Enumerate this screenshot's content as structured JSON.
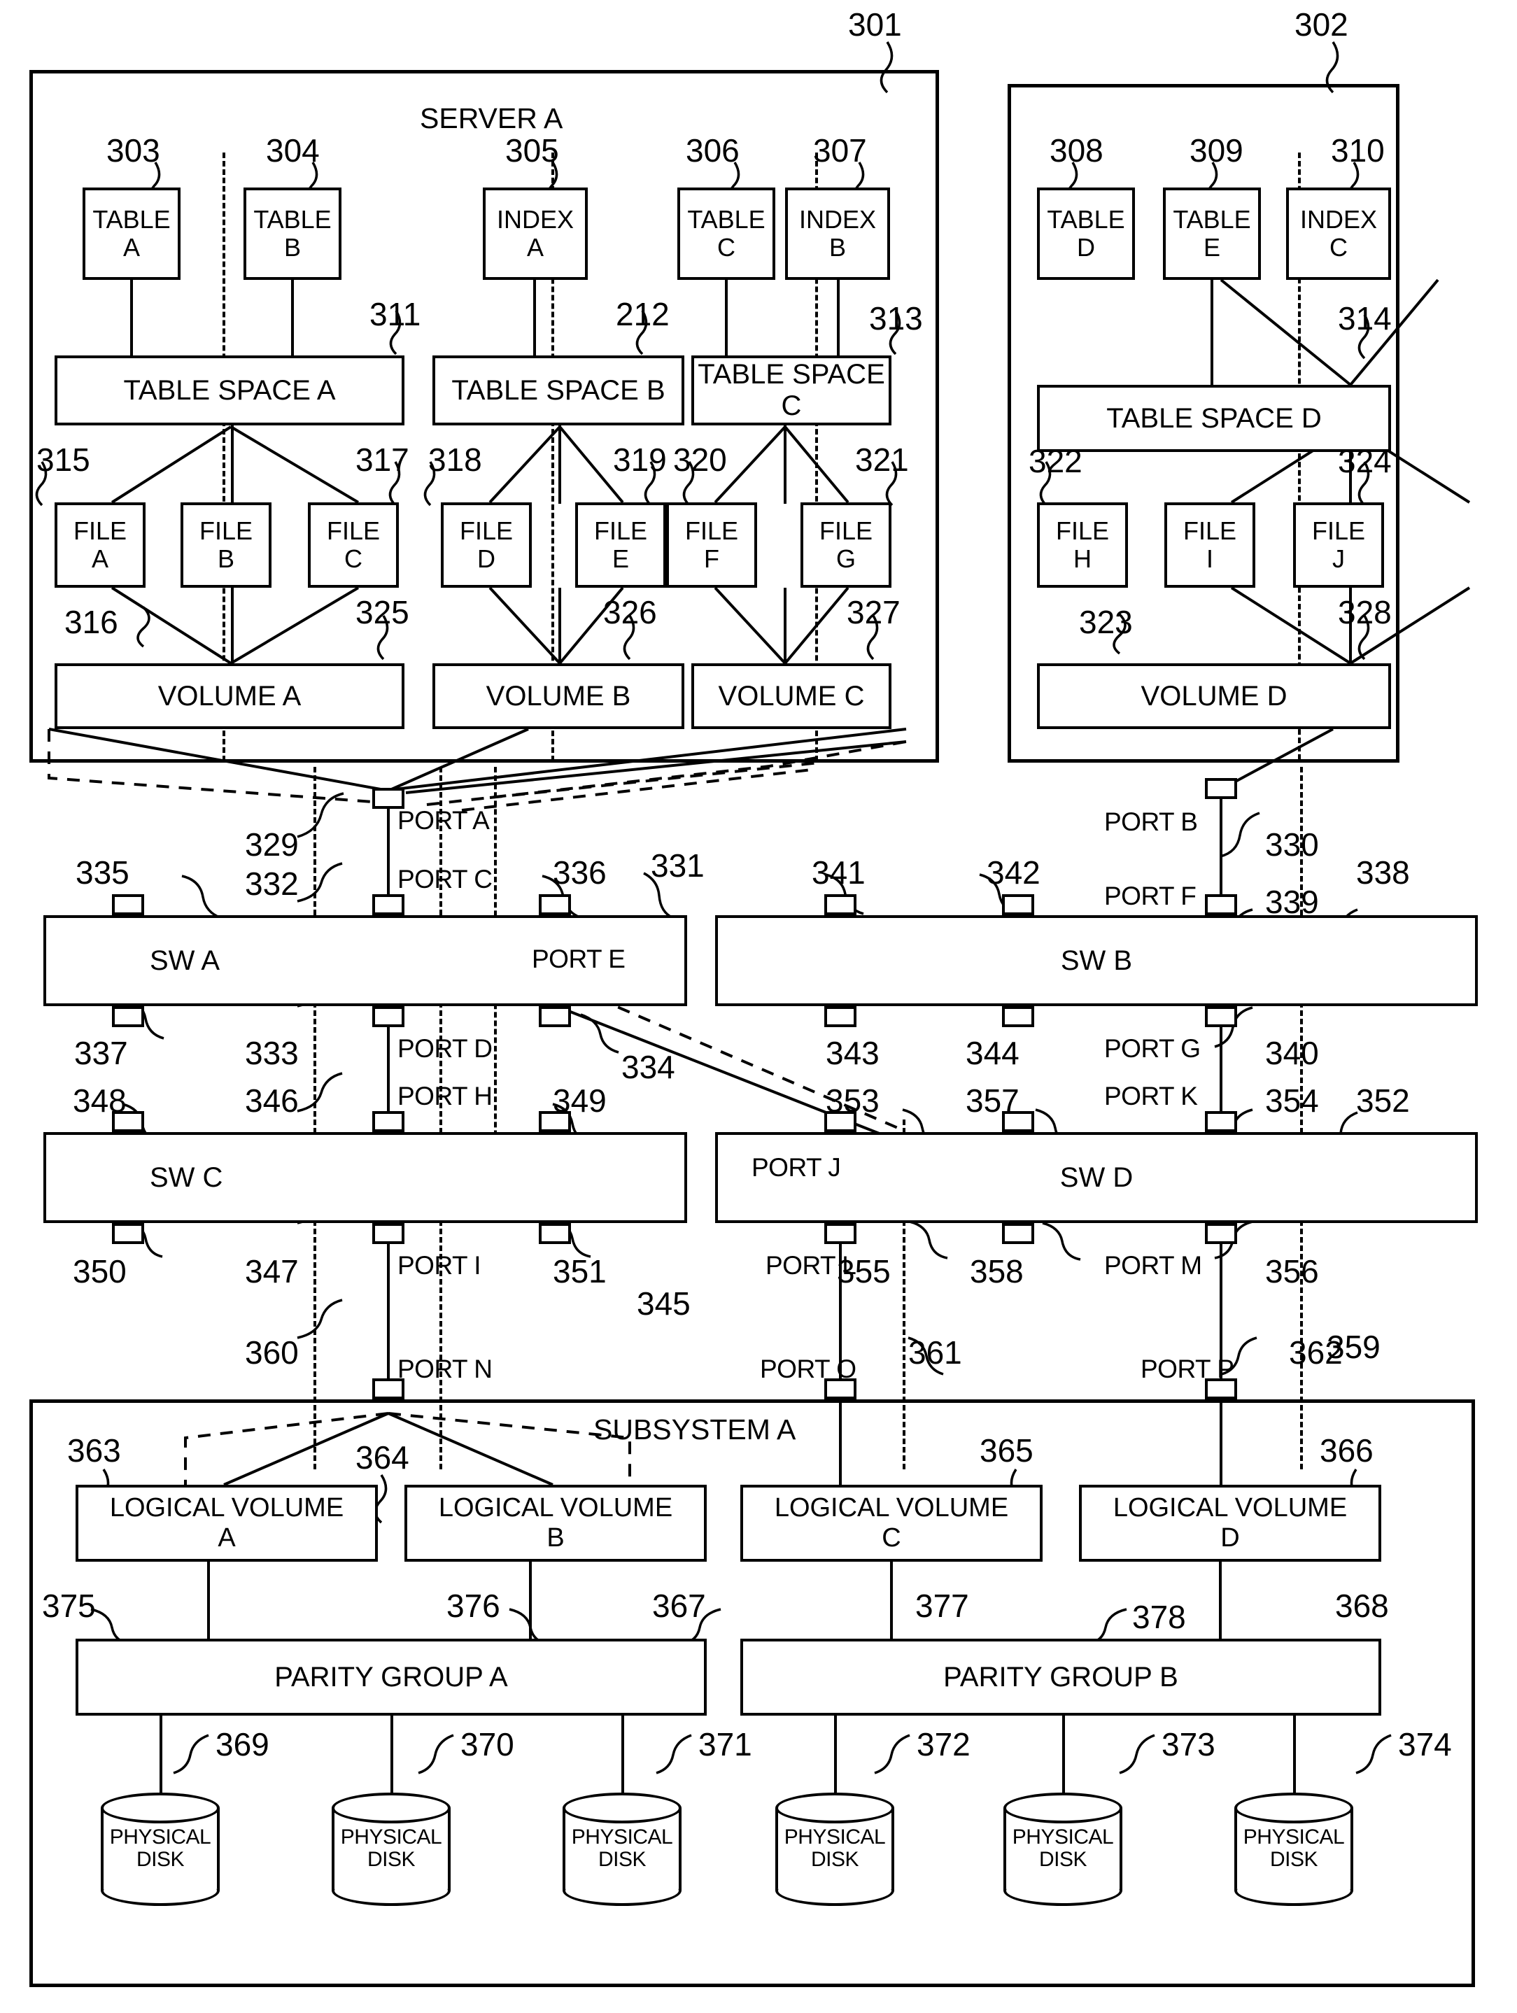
{
  "figure": {
    "servers": [
      {
        "ref": "301",
        "title": "SERVER A",
        "objects": [
          {
            "ref": "303",
            "line1": "TABLE",
            "line2": "A"
          },
          {
            "ref": "304",
            "line1": "TABLE",
            "line2": "B"
          },
          {
            "ref": "305",
            "line1": "INDEX",
            "line2": "A"
          },
          {
            "ref": "306",
            "line1": "TABLE",
            "line2": "C"
          },
          {
            "ref": "307",
            "line1": "INDEX",
            "line2": "B"
          }
        ],
        "table_spaces": [
          {
            "ref": "311",
            "label": "TABLE SPACE A"
          },
          {
            "ref": "212",
            "label": "TABLE SPACE B"
          },
          {
            "ref": "313",
            "label": "TABLE SPACE C"
          }
        ],
        "files": [
          {
            "ref": "315",
            "line1": "FILE",
            "line2": "A"
          },
          {
            "ref": "316",
            "line1": "FILE",
            "line2": "B"
          },
          {
            "ref": "317",
            "line1": "FILE",
            "line2": "C"
          },
          {
            "ref": "318",
            "line1": "FILE",
            "line2": "D"
          },
          {
            "ref": "319",
            "line1": "FILE",
            "line2": "E"
          },
          {
            "ref": "320",
            "line1": "FILE",
            "line2": "F"
          },
          {
            "ref": "321",
            "line1": "FILE",
            "line2": "G"
          }
        ],
        "volumes": [
          {
            "ref": "325",
            "label": "VOLUME A"
          },
          {
            "ref": "326",
            "label": "VOLUME B"
          },
          {
            "ref": "327",
            "label": "VOLUME C"
          }
        ]
      },
      {
        "ref": "302",
        "title": "",
        "objects": [
          {
            "ref": "308",
            "line1": "TABLE",
            "line2": "D"
          },
          {
            "ref": "309",
            "line1": "TABLE",
            "line2": "E"
          },
          {
            "ref": "310",
            "line1": "INDEX",
            "line2": "C"
          }
        ],
        "table_spaces": [
          {
            "ref": "314",
            "label": "TABLE SPACE D"
          }
        ],
        "files": [
          {
            "ref": "322",
            "line1": "FILE",
            "line2": "H"
          },
          {
            "ref": "323",
            "line1": "FILE",
            "line2": "I"
          },
          {
            "ref": "324",
            "line1": "FILE",
            "line2": "J"
          }
        ],
        "volumes": [
          {
            "ref": "328",
            "label": "VOLUME D"
          }
        ]
      }
    ],
    "server_ports": [
      {
        "ref": "329",
        "label": "PORT A"
      },
      {
        "ref": "330",
        "label": "PORT B"
      }
    ],
    "switches": [
      {
        "ref": "335",
        "label": "SW A",
        "top_ports": [
          {
            "ref": "335",
            "label": ""
          },
          {
            "ref": "332",
            "label": "PORT C"
          },
          {
            "ref": "336",
            "label": ""
          }
        ],
        "bottom_ports": [
          {
            "ref": "337",
            "label": ""
          },
          {
            "ref": "333",
            "label": "PORT D"
          },
          {
            "ref": "334",
            "label": "PORT E"
          }
        ],
        "edge_ref": "331"
      },
      {
        "ref": "338",
        "label": "SW B",
        "top_ports": [
          {
            "ref": "341",
            "label": ""
          },
          {
            "ref": "342",
            "label": ""
          },
          {
            "ref": "339",
            "label": "PORT F"
          }
        ],
        "bottom_ports": [
          {
            "ref": "343",
            "label": ""
          },
          {
            "ref": "344",
            "label": ""
          },
          {
            "ref": "340",
            "label": "PORT G"
          }
        ],
        "edge_ref": "338"
      },
      {
        "ref": "345",
        "label": "SW C",
        "top_ports": [
          {
            "ref": "348",
            "label": ""
          },
          {
            "ref": "346",
            "label": "PORT H"
          },
          {
            "ref": "349",
            "label": ""
          }
        ],
        "bottom_ports": [
          {
            "ref": "350",
            "label": ""
          },
          {
            "ref": "347",
            "label": "PORT I"
          },
          {
            "ref": "351",
            "label": ""
          }
        ],
        "edge_ref": "345"
      },
      {
        "ref": "352",
        "label": "SW D",
        "top_ports": [
          {
            "ref": "353",
            "label": "PORT J"
          },
          {
            "ref": "357",
            "label": ""
          },
          {
            "ref": "354",
            "label": "PORT K"
          }
        ],
        "bottom_ports": [
          {
            "ref": "355",
            "label": "PORT L"
          },
          {
            "ref": "358",
            "label": ""
          },
          {
            "ref": "356",
            "label": "PORT M"
          }
        ],
        "edge_ref": "352"
      }
    ],
    "subsystem": {
      "ref": "359",
      "title": "SUBSYSTEM A",
      "ports": [
        {
          "ref": "360",
          "label": "PORT N"
        },
        {
          "ref": "361",
          "label": "PORT O"
        },
        {
          "ref": "362",
          "label": "PORT P"
        }
      ],
      "logical_volumes": [
        {
          "ref": "363",
          "line1": "LOGICAL VOLUME",
          "line2": "A"
        },
        {
          "ref": "364",
          "line1": "LOGICAL VOLUME",
          "line2": "B"
        },
        {
          "ref": "365",
          "line1": "LOGICAL VOLUME",
          "line2": "C"
        },
        {
          "ref": "366",
          "line1": "LOGICAL VOLUME",
          "line2": "D"
        }
      ],
      "parity_groups": [
        {
          "ref": "367",
          "label": "PARITY GROUP A",
          "arrow_refs": [
            "375",
            "376"
          ]
        },
        {
          "ref": "368",
          "label": "PARITY GROUP B",
          "arrow_refs": [
            "377",
            "378"
          ]
        }
      ],
      "physical_disks": [
        {
          "ref": "369",
          "line1": "PHYSICAL",
          "line2": "DISK"
        },
        {
          "ref": "370",
          "line1": "PHYSICAL",
          "line2": "DISK"
        },
        {
          "ref": "371",
          "line1": "PHYSICAL",
          "line2": "DISK"
        },
        {
          "ref": "372",
          "line1": "PHYSICAL",
          "line2": "DISK"
        },
        {
          "ref": "373",
          "line1": "PHYSICAL",
          "line2": "DISK"
        },
        {
          "ref": "374",
          "line1": "PHYSICAL",
          "line2": "DISK"
        }
      ]
    },
    "reference_numerals": [
      "301",
      "302",
      "303",
      "304",
      "305",
      "306",
      "307",
      "308",
      "309",
      "310",
      "311",
      "212",
      "313",
      "314",
      "315",
      "316",
      "317",
      "318",
      "319",
      "320",
      "321",
      "322",
      "323",
      "324",
      "325",
      "326",
      "327",
      "328",
      "329",
      "330",
      "331",
      "332",
      "333",
      "334",
      "335",
      "336",
      "337",
      "338",
      "339",
      "340",
      "341",
      "342",
      "343",
      "344",
      "345",
      "346",
      "347",
      "348",
      "349",
      "350",
      "351",
      "352",
      "353",
      "354",
      "355",
      "356",
      "357",
      "358",
      "359",
      "360",
      "361",
      "362",
      "363",
      "364",
      "365",
      "366",
      "367",
      "368",
      "369",
      "370",
      "371",
      "372",
      "373",
      "374",
      "375",
      "376",
      "377",
      "378"
    ]
  }
}
